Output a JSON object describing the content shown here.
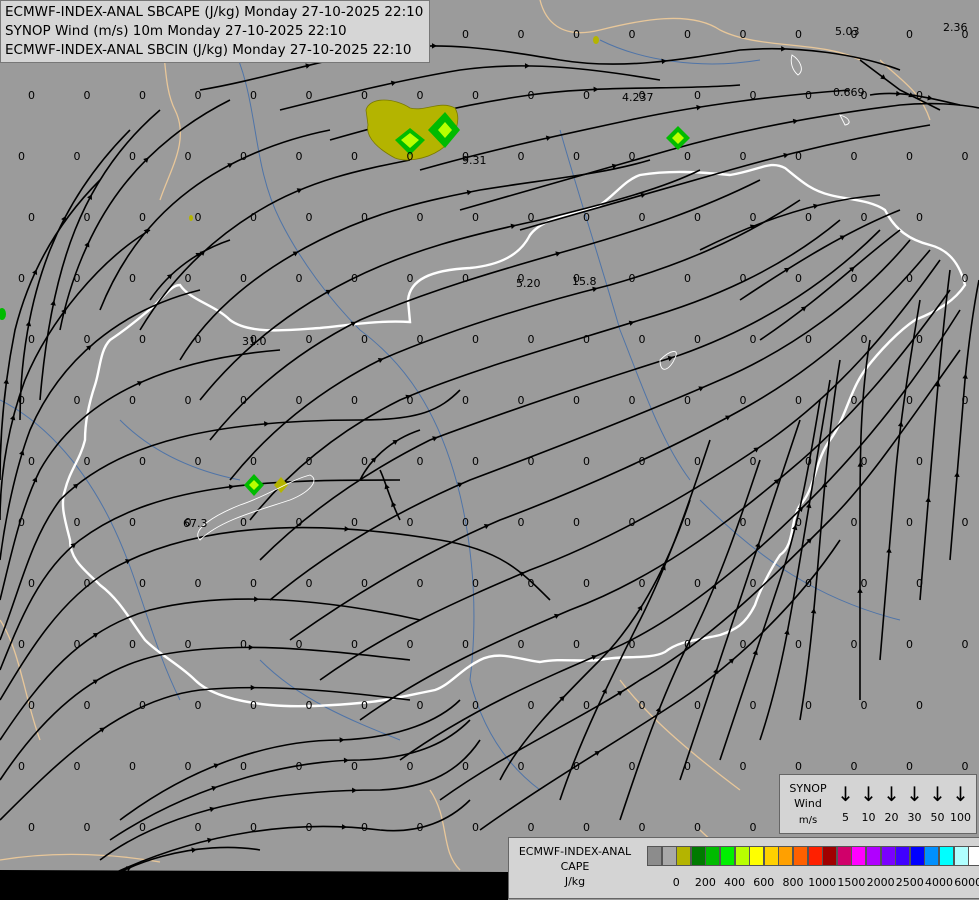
{
  "title": {
    "line1": "ECMWF-INDEX-ANAL SBCAPE (J/kg) Monday 27-10-2025 22:10",
    "line2": "SYNOP Wind (m/s) 10m Monday 27-10-2025 22:10",
    "line3": "ECMWF-INDEX-ANAL SBCIN (J/kg) Monday 27-10-2025 22:10"
  },
  "colors": {
    "background": "#9b9b9b",
    "country_border": "#ffffff",
    "neighbour_border": "#e8c79a",
    "river": "#4f74a8",
    "streamline": "#000000"
  },
  "special_values": [
    "5.03",
    "2.36",
    "4.237",
    "0.669",
    "9.31",
    "5.20",
    "15.8",
    "31.0",
    "67.3"
  ],
  "wind_legend": {
    "title": [
      "SYNOP",
      "Wind"
    ],
    "unit": "m/s",
    "ticks": [
      "5",
      "10",
      "20",
      "30",
      "50",
      "100"
    ]
  },
  "cape_legend": {
    "title": [
      "ECMWF-INDEX-ANAL",
      "CAPE"
    ],
    "unit": "J/kg",
    "colors": [
      "#8c8c8c",
      "#a8a8a8",
      "#b4b400",
      "#007a00",
      "#00bb00",
      "#00f000",
      "#b8ff00",
      "#ffff00",
      "#ffd000",
      "#ffa000",
      "#ff6000",
      "#ff2000",
      "#a00000",
      "#d0006a",
      "#ff00ff",
      "#b000ff",
      "#7a00ff",
      "#4000ff",
      "#0000ff",
      "#0090ff",
      "#00ffff",
      "#b0ffff",
      "#ffffff"
    ],
    "ticks": [
      "0",
      "200",
      "400",
      "600",
      "800",
      "1000",
      "1500",
      "2000",
      "2500",
      "4000",
      "6000"
    ]
  }
}
